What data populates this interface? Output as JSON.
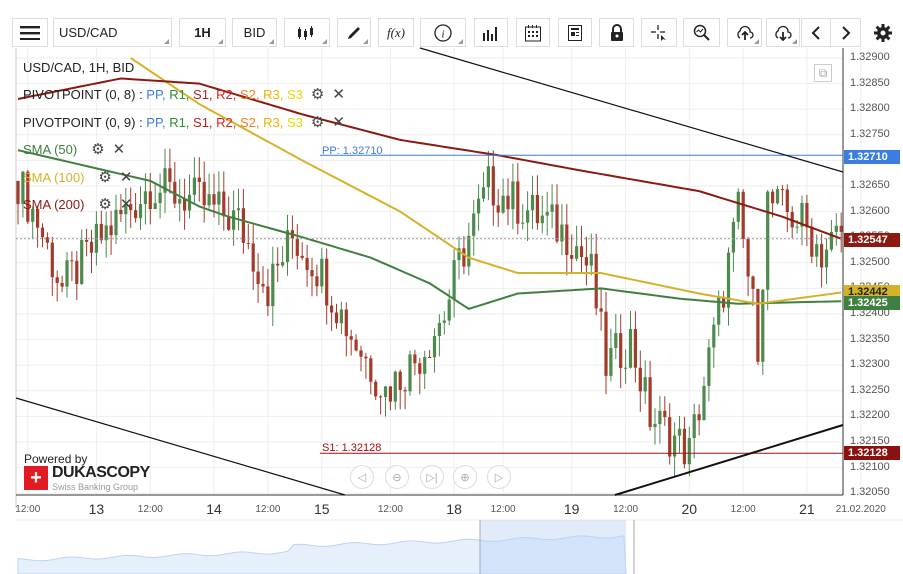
{
  "toolbar": {
    "symbol": "USD/CAD",
    "timeframe": "1H",
    "price_type": "BID",
    "fx_label": "f(x)"
  },
  "legend": {
    "title": "USD/CAD, 1H, BID",
    "pivot1": "PIVOTPOINT (0, 8)",
    "pivot2": "PIVOTPOINT (0, 9)",
    "pivot_sep": " : ",
    "pivot_items": [
      {
        "t": "PP",
        "c": "#3b7de0"
      },
      {
        "t": "R1",
        "c": "#2e8b2e"
      },
      {
        "t": "S1",
        "c": "#b22222"
      },
      {
        "t": "R2",
        "c": "#e02020"
      },
      {
        "t": "S2",
        "c": "#f08020"
      },
      {
        "t": "R3",
        "c": "#f0b000"
      },
      {
        "t": "S3",
        "c": "#e8d800"
      }
    ],
    "sma50": "SMA (50)",
    "sma100": "SMA (100)",
    "sma200": "SMA (200)"
  },
  "lines": {
    "pp_label": "PP: 1.32710",
    "s1_label": "S1: 1.32128"
  },
  "badges": {
    "pp": "1.32710",
    "sma200": "1.32547",
    "sma100": "1.32442",
    "sma50": "1.32425",
    "s1": "1.32128"
  },
  "colors": {
    "up": "#4d8a4d",
    "down": "#a33a2a",
    "sma50": "#3f7f3f",
    "sma100": "#d4b22a",
    "sma200": "#8b1a10",
    "pp": "#3b7de0",
    "s1": "#a01010"
  },
  "branding": {
    "powered": "Powered by",
    "name": "DUKASCOPY",
    "tagline": "Swiss Banking Group"
  },
  "chart_data": {
    "type": "candlestick",
    "yrange": [
      1.3205,
      1.329
    ],
    "y_ticks": [
      "1.32900",
      "1.32850",
      "1.32800",
      "1.32750",
      "1.32700",
      "1.32650",
      "1.32600",
      "1.32550",
      "1.32500",
      "1.32450",
      "1.32400",
      "1.32350",
      "1.32300",
      "1.32250",
      "1.32200",
      "1.32150",
      "1.32100",
      "1.32050"
    ],
    "x_labels": [
      {
        "t": "12:00",
        "h": 2
      },
      {
        "t": "13",
        "h": 16
      },
      {
        "t": "12:00",
        "h": 27
      },
      {
        "t": "14",
        "h": 40
      },
      {
        "t": "12:00",
        "h": 51
      },
      {
        "t": "15",
        "h": 62
      },
      {
        "t": "12:00",
        "h": 76
      },
      {
        "t": "18",
        "h": 89
      },
      {
        "t": "12:00",
        "h": 99
      },
      {
        "t": "19",
        "h": 113
      },
      {
        "t": "12:00",
        "h": 124
      },
      {
        "t": "20",
        "h": 137
      },
      {
        "t": "12:00",
        "h": 148
      },
      {
        "t": "21",
        "h": 161
      },
      {
        "t": "21.02.2020",
        "h": 172
      }
    ],
    "close_path": [
      [
        0,
        1.3266
      ],
      [
        4,
        1.3258
      ],
      [
        9,
        1.3245
      ],
      [
        17,
        1.3255
      ],
      [
        27,
        1.3265
      ],
      [
        37,
        1.3262
      ],
      [
        45,
        1.3258
      ],
      [
        51,
        1.3245
      ],
      [
        56,
        1.3255
      ],
      [
        62,
        1.3248
      ],
      [
        68,
        1.3236
      ],
      [
        75,
        1.3225
      ],
      [
        82,
        1.3232
      ],
      [
        87,
        1.324
      ],
      [
        90,
        1.325
      ],
      [
        96,
        1.3265
      ],
      [
        101,
        1.3262
      ],
      [
        108,
        1.3258
      ],
      [
        113,
        1.3255
      ],
      [
        117,
        1.3248
      ],
      [
        120,
        1.323
      ],
      [
        125,
        1.3235
      ],
      [
        129,
        1.322
      ],
      [
        137,
        1.3213
      ],
      [
        143,
        1.324
      ],
      [
        147,
        1.326
      ],
      [
        151,
        1.3235
      ],
      [
        153,
        1.3262
      ],
      [
        160,
        1.3258
      ],
      [
        164,
        1.3252
      ],
      [
        168,
        1.3256
      ]
    ],
    "sma50": [
      [
        0,
        1.3272
      ],
      [
        27,
        1.3266
      ],
      [
        37,
        1.3261
      ],
      [
        43,
        1.3259
      ],
      [
        58,
        1.3255
      ],
      [
        72,
        1.3251
      ],
      [
        84,
        1.3246
      ],
      [
        92,
        1.3241
      ],
      [
        102,
        1.3244
      ],
      [
        119,
        1.3245
      ],
      [
        135,
        1.3243
      ],
      [
        147,
        1.3242
      ],
      [
        168,
        1.32425
      ]
    ],
    "sma100": [
      [
        23,
        1.329
      ],
      [
        37,
        1.3281
      ],
      [
        58,
        1.327
      ],
      [
        78,
        1.326
      ],
      [
        92,
        1.3251
      ],
      [
        102,
        1.3248
      ],
      [
        119,
        1.3248
      ],
      [
        139,
        1.3244
      ],
      [
        151,
        1.3242
      ],
      [
        168,
        1.32442
      ]
    ],
    "sma200": [
      [
        0,
        1.3282
      ],
      [
        21,
        1.3286
      ],
      [
        37,
        1.3285
      ],
      [
        58,
        1.3279
      ],
      [
        78,
        1.3274
      ],
      [
        98,
        1.3271
      ],
      [
        115,
        1.3268
      ],
      [
        139,
        1.3264
      ],
      [
        156,
        1.3259
      ],
      [
        168,
        1.32547
      ]
    ],
    "pp": 1.3271,
    "s1": 1.32128,
    "last": 1.32547
  }
}
